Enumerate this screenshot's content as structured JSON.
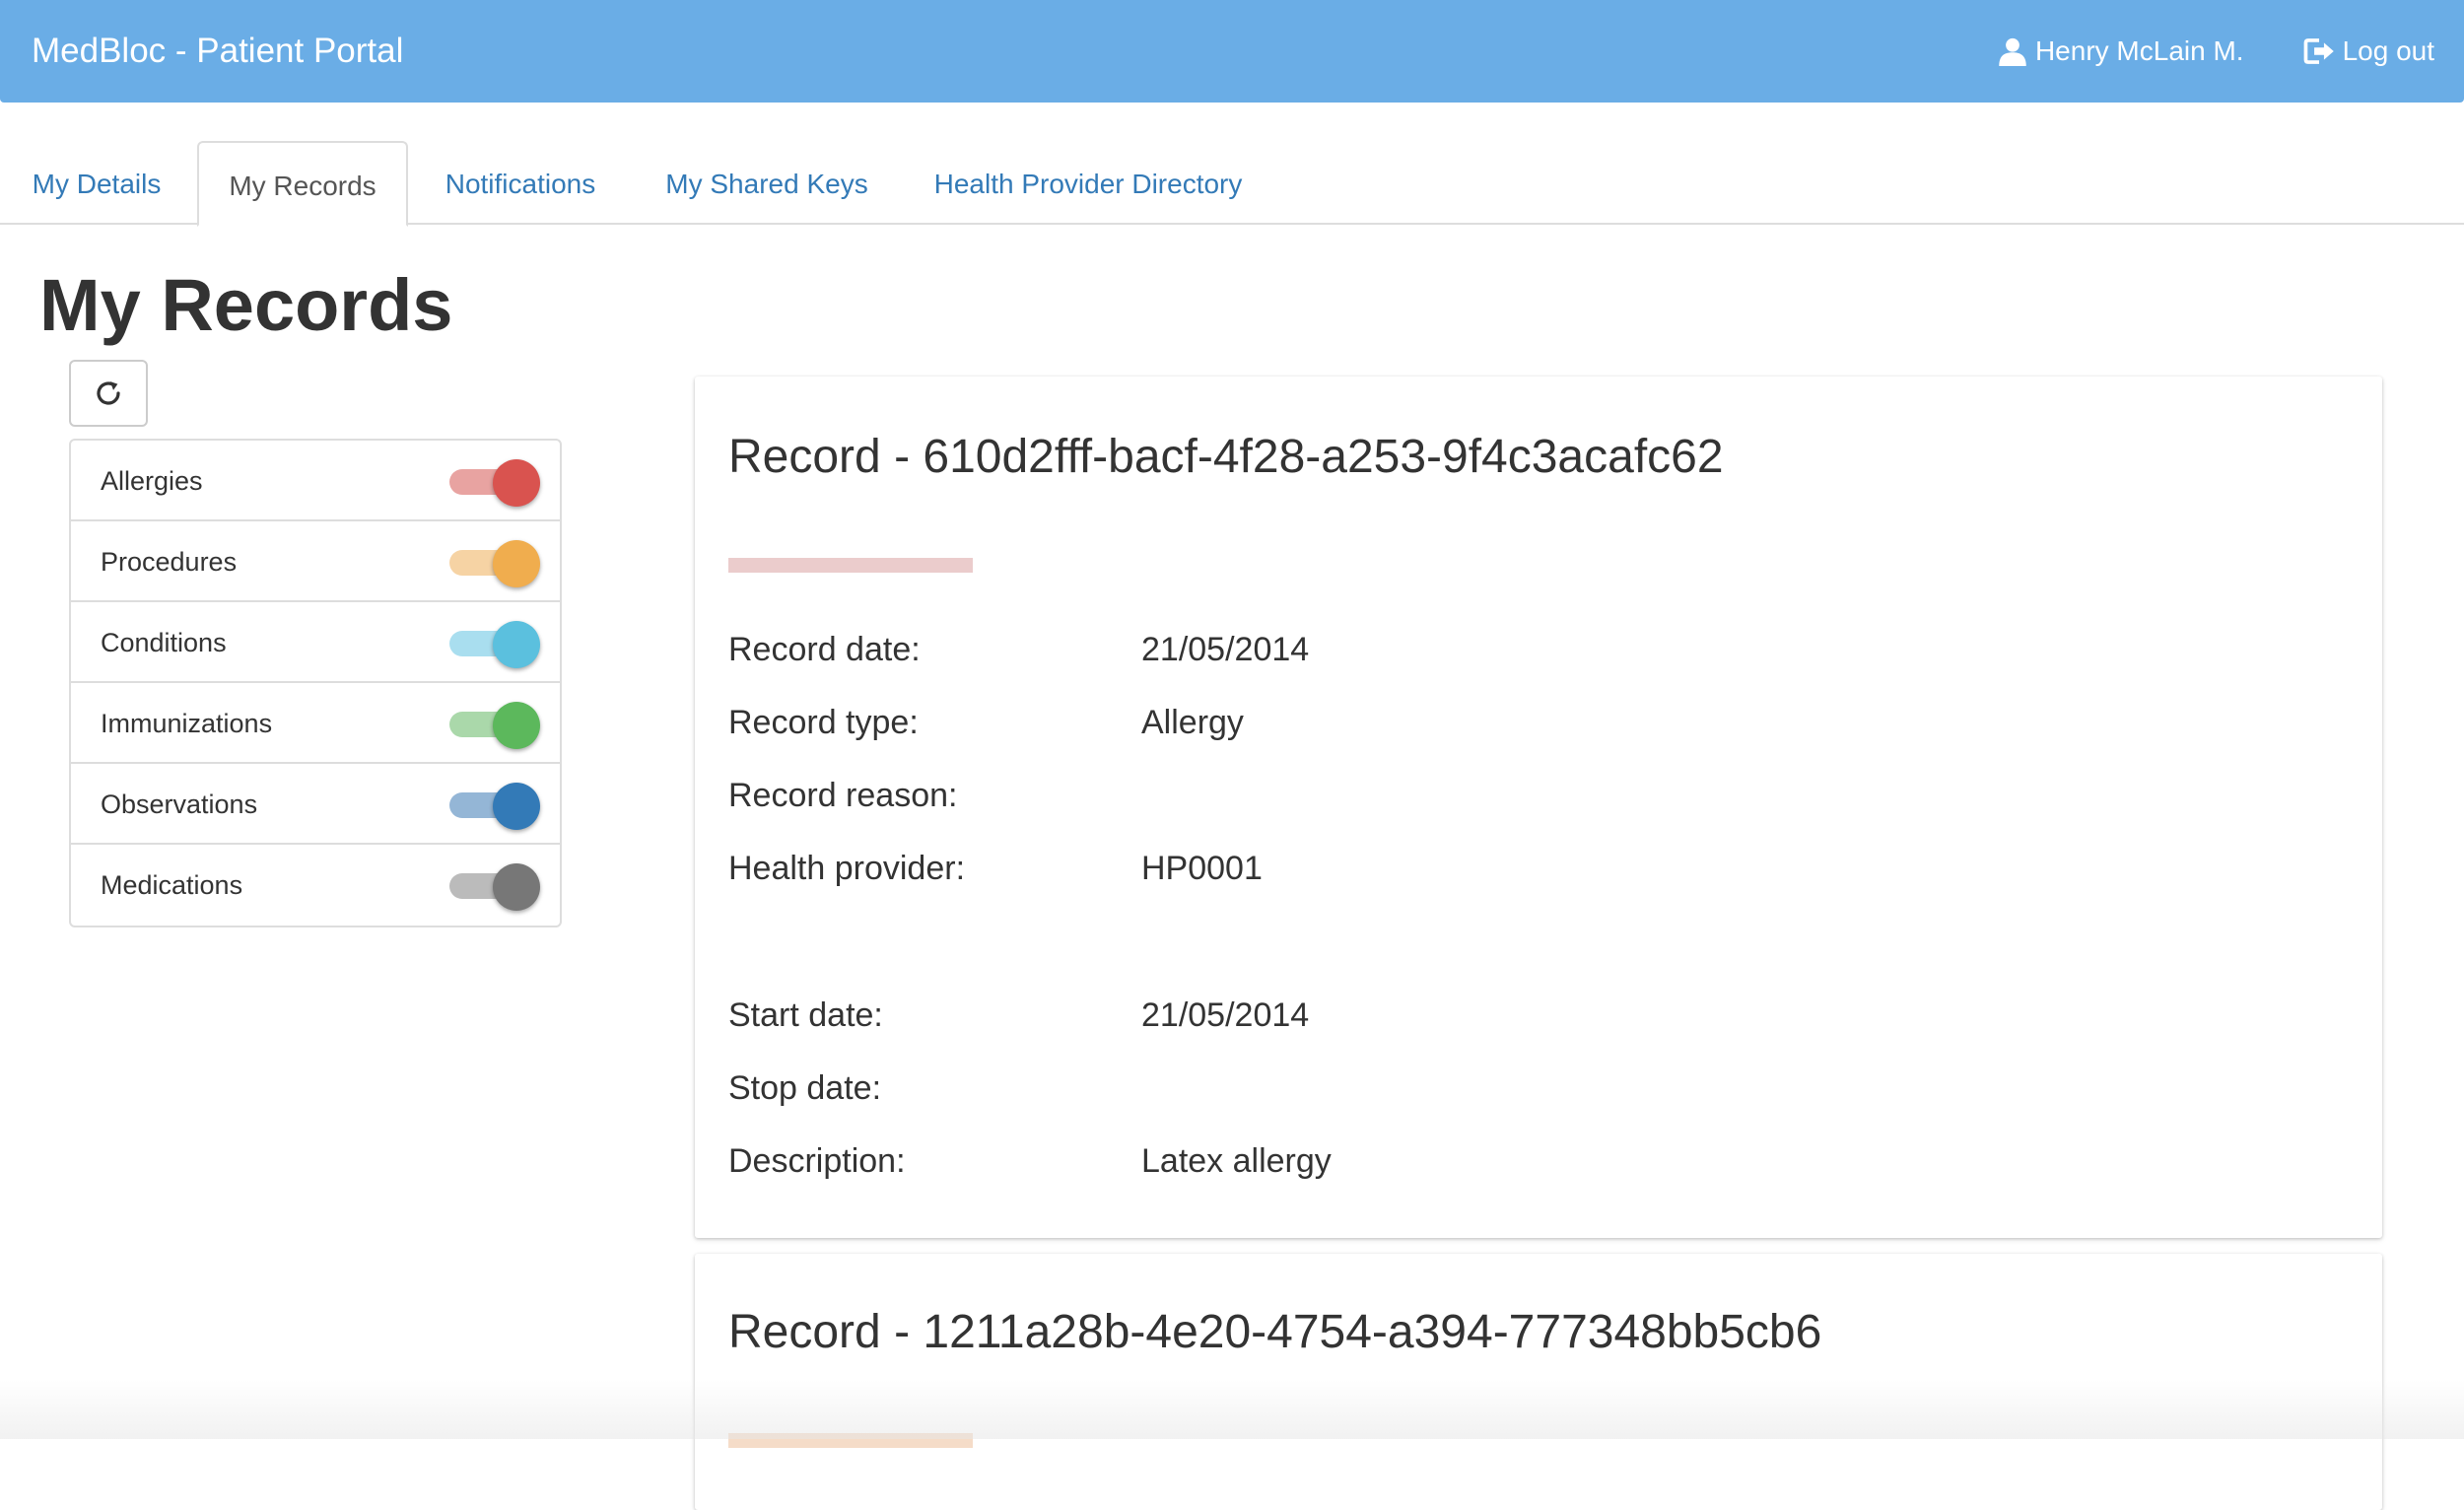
{
  "navbar": {
    "brand": "MedBloc - Patient Portal",
    "user_name": "Henry McLain M.",
    "user_icon": "user-icon",
    "logout_label": "Log out",
    "logout_icon": "logout-icon",
    "background_color": "#6aade6"
  },
  "tabs": [
    {
      "label": "My Details",
      "active": false
    },
    {
      "label": "My Records",
      "active": true
    },
    {
      "label": "Notifications",
      "active": false
    },
    {
      "label": "My Shared Keys",
      "active": false
    },
    {
      "label": "Health Provider Directory",
      "active": false
    }
  ],
  "page": {
    "title": "My Records",
    "refresh_icon": "refresh-icon"
  },
  "filters": [
    {
      "label": "Allergies",
      "enabled": true,
      "color": "#d9534f"
    },
    {
      "label": "Procedures",
      "enabled": true,
      "color": "#f0ad4e"
    },
    {
      "label": "Conditions",
      "enabled": true,
      "color": "#5bc0de"
    },
    {
      "label": "Immunizations",
      "enabled": true,
      "color": "#5cb85c"
    },
    {
      "label": "Observations",
      "enabled": true,
      "color": "#337ab7"
    },
    {
      "label": "Medications",
      "enabled": true,
      "color": "#777777"
    }
  ],
  "records": [
    {
      "title": "Record - 610d2fff-bacf-4f28-a253-9f4c3acafc62",
      "bar_color": "#ebcccc",
      "fields": {
        "record_date_label": "Record date:",
        "record_date": "21/05/2014",
        "record_type_label": "Record type:",
        "record_type": "Allergy",
        "record_reason_label": "Record reason:",
        "record_reason": "",
        "health_provider_label": "Health provider:",
        "health_provider": "HP0001",
        "start_date_label": "Start date:",
        "start_date": "21/05/2014",
        "stop_date_label": "Stop date:",
        "stop_date": "",
        "description_label": "Description:",
        "description": "Latex allergy"
      }
    },
    {
      "title": "Record - 1211a28b-4e20-4754-a394-777348bb5cb6",
      "bar_color": "#f5dcc8"
    }
  ]
}
